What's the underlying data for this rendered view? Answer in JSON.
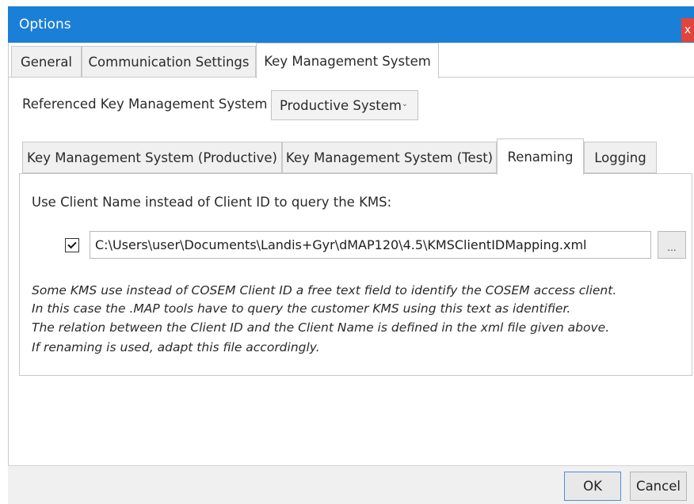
{
  "window": {
    "title": "Options",
    "close_label": "x"
  },
  "top_tabs": [
    {
      "label": "General",
      "active": false
    },
    {
      "label": "Communication Settings",
      "active": false
    },
    {
      "label": "Key Management System",
      "active": true
    }
  ],
  "referenced_kms": {
    "label": "Referenced Key Management System",
    "selected": "Productive System"
  },
  "inner_tabs": [
    {
      "label": "Key Management System (Productive)",
      "active": false
    },
    {
      "label": "Key Management System (Test)",
      "active": false
    },
    {
      "label": "Renaming",
      "active": true
    },
    {
      "label": "Logging",
      "active": false
    }
  ],
  "renaming": {
    "use_client_name_label": "Use Client Name instead of Client ID to query the KMS:",
    "checked": true,
    "mapping_path": "C:\\Users\\user\\Documents\\Landis+Gyr\\dMAP120\\4.5\\KMSClientIDMapping.xml",
    "browse_label": "...",
    "description": [
      "Some KMS use instead of COSEM Client ID a free text field to identify the COSEM access client.",
      "In this case the .MAP tools have to query the customer KMS using this text as identifier.",
      "The relation between the Client ID and the Client Name is defined in the xml file given above.",
      "If renaming is used, adapt this file accordingly."
    ]
  },
  "footer": {
    "ok_label": "OK",
    "cancel_label": "Cancel"
  },
  "colors": {
    "titlebar": "#1a7fd7",
    "close": "#e2443c",
    "border": "#c8c8c8"
  }
}
